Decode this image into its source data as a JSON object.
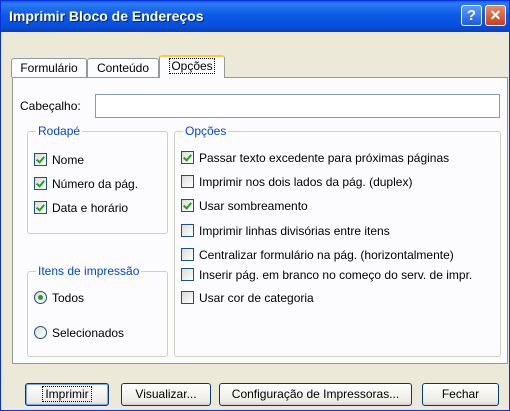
{
  "window": {
    "title": "Imprimir Bloco de Endereços",
    "help_icon": "?",
    "close_icon": "✕"
  },
  "tabs": [
    {
      "label": "Formulário",
      "active": false
    },
    {
      "label": "Conteúdo",
      "active": false
    },
    {
      "label": "Opções",
      "active": true
    }
  ],
  "header_field": {
    "label": "Cabeçalho:",
    "value": ""
  },
  "footer_group": {
    "legend": "Rodapé",
    "items": [
      {
        "label": "Nome",
        "checked": true
      },
      {
        "label": "Número da pág.",
        "checked": true
      },
      {
        "label": "Data e horário",
        "checked": true
      }
    ]
  },
  "print_items_group": {
    "legend": "Itens de impressão",
    "items": [
      {
        "label": "Todos",
        "selected": true
      },
      {
        "label": "Selecionados",
        "selected": false
      }
    ]
  },
  "options_group": {
    "legend": "Opções",
    "items": [
      {
        "label": "Passar texto excedente para próximas páginas",
        "checked": true
      },
      {
        "label": "Imprimir nos dois lados da pág. (duplex)",
        "checked": false
      },
      {
        "label": "Usar sombreamento",
        "checked": true
      },
      {
        "label": "Imprimir linhas divisórias entre itens",
        "checked": false
      },
      {
        "label": "Centralizar formulário na pág. (horizontalmente)",
        "checked": false
      },
      {
        "label": "Inserir pág. em branco no começo do serv. de impr.",
        "checked": false
      },
      {
        "label": "Usar cor de categoria",
        "checked": false
      }
    ]
  },
  "buttons": {
    "print": "Imprimir",
    "preview": "Visualizar...",
    "printer_config": "Configuração de Impressoras...",
    "close": "Fechar"
  }
}
